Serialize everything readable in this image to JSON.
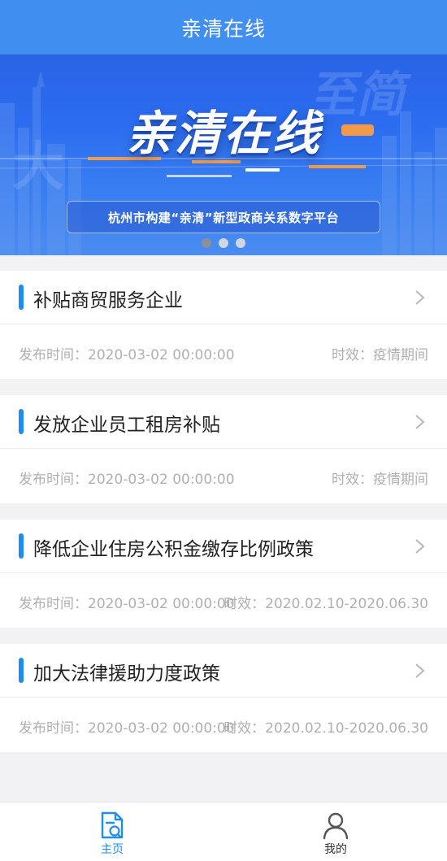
{
  "header": {
    "title": "亲清在线"
  },
  "banner": {
    "big_title": "亲清在线",
    "subtitle": "杭州市构建“亲清”新型政商关系数字平台",
    "watermark_left": "大",
    "watermark_right": "至简",
    "slides": 3,
    "active_slide": 1
  },
  "items": [
    {
      "title": "补贴商贸服务企业",
      "publish": "发布时间：2020-03-02 00:00:00",
      "validity": "时效：疫情期间"
    },
    {
      "title": "发放企业员工租房补贴",
      "publish": "发布时间：2020-03-02 00:00:00",
      "validity": "时效：疫情期间"
    },
    {
      "title": "降低企业住房公积金缴存比例政策",
      "publish": "发布时间：2020-03-02 00:00:00",
      "validity": "时效：2020.02.10-2020.06.30"
    },
    {
      "title": "加大法律援助力度政策",
      "publish": "发布时间：2020-03-02 00:00:00",
      "validity": "时效：2020.02.10-2020.06.30"
    }
  ],
  "tabbar": {
    "home_label": "主页",
    "mine_label": "我的",
    "active_color": "#1e8cf2"
  }
}
